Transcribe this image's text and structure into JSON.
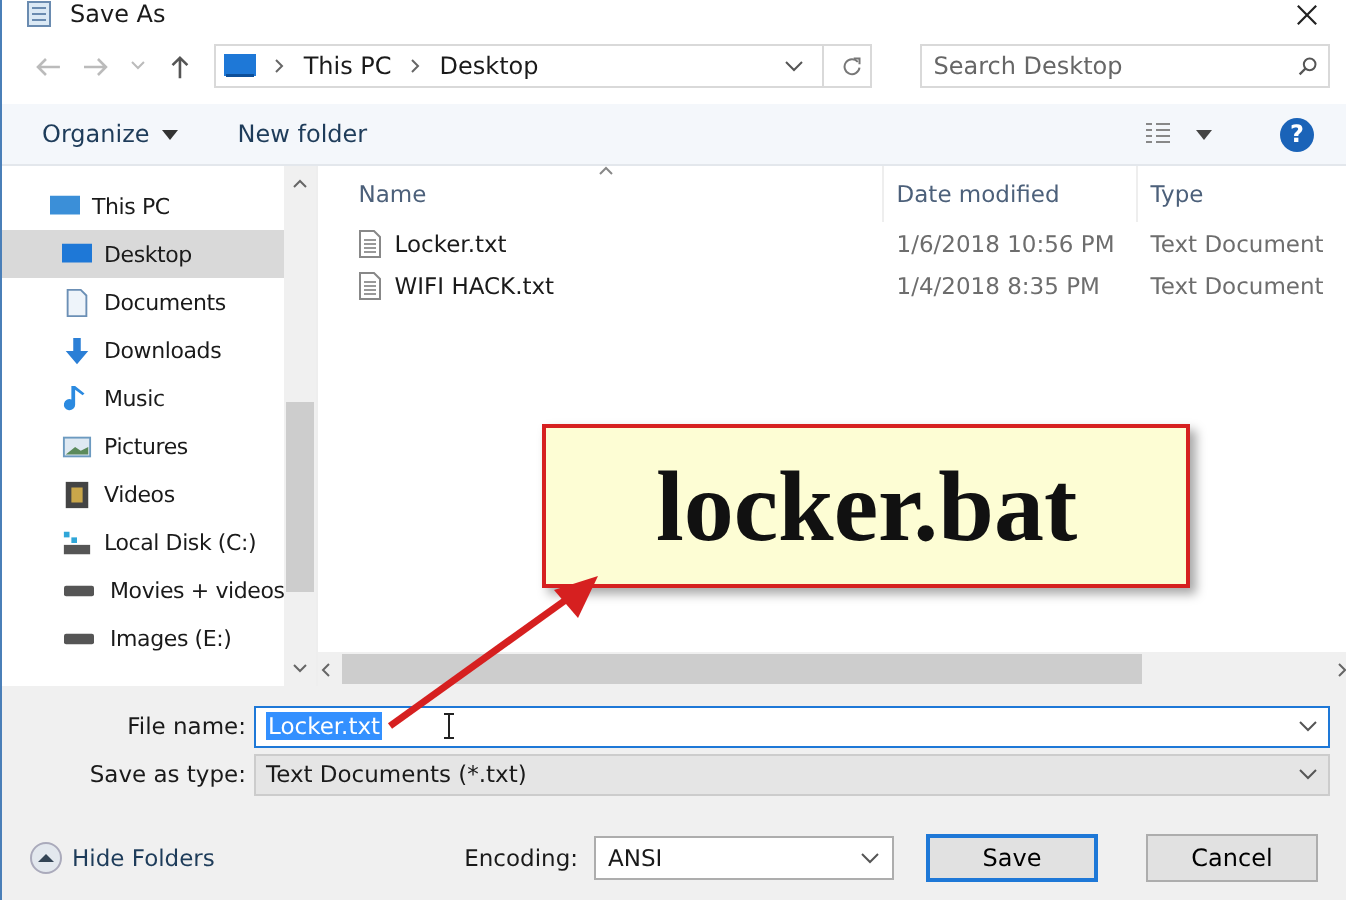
{
  "window": {
    "title": "Save As"
  },
  "address": {
    "crumbs": [
      "This PC",
      "Desktop"
    ]
  },
  "search": {
    "placeholder": "Search Desktop"
  },
  "toolbar": {
    "organize": "Organize",
    "new_folder": "New folder",
    "help": "?"
  },
  "sidebar": {
    "items": [
      {
        "label": "This PC",
        "kind": "pc",
        "selected": false
      },
      {
        "label": "Desktop",
        "kind": "desktop",
        "selected": true
      },
      {
        "label": "Documents",
        "kind": "documents",
        "selected": false
      },
      {
        "label": "Downloads",
        "kind": "downloads",
        "selected": false
      },
      {
        "label": "Music",
        "kind": "music",
        "selected": false
      },
      {
        "label": "Pictures",
        "kind": "pictures",
        "selected": false
      },
      {
        "label": "Videos",
        "kind": "videos",
        "selected": false
      },
      {
        "label": "Local Disk (C:)",
        "kind": "disk",
        "selected": false
      },
      {
        "label": "Movies + videos",
        "kind": "drive",
        "selected": false
      },
      {
        "label": "Images (E:)",
        "kind": "drive",
        "selected": false
      }
    ]
  },
  "table": {
    "columns": [
      "Name",
      "Date modified",
      "Type"
    ],
    "rows": [
      {
        "name": "Locker.txt",
        "date": "1/6/2018 10:56 PM",
        "type": "Text Document"
      },
      {
        "name": "WIFI HACK.txt",
        "date": "1/4/2018 8:35 PM",
        "type": "Text Document"
      }
    ]
  },
  "callout": {
    "text": "locker.bat"
  },
  "form": {
    "file_name_label": "File name:",
    "file_name": "Locker.txt",
    "type_label": "Save as type:",
    "type_value": "Text Documents (*.txt)"
  },
  "footer": {
    "hide_folders": "Hide Folders",
    "encoding_label": "Encoding:",
    "encoding": "ANSI",
    "buttons": [
      "Save",
      "Cancel"
    ]
  }
}
